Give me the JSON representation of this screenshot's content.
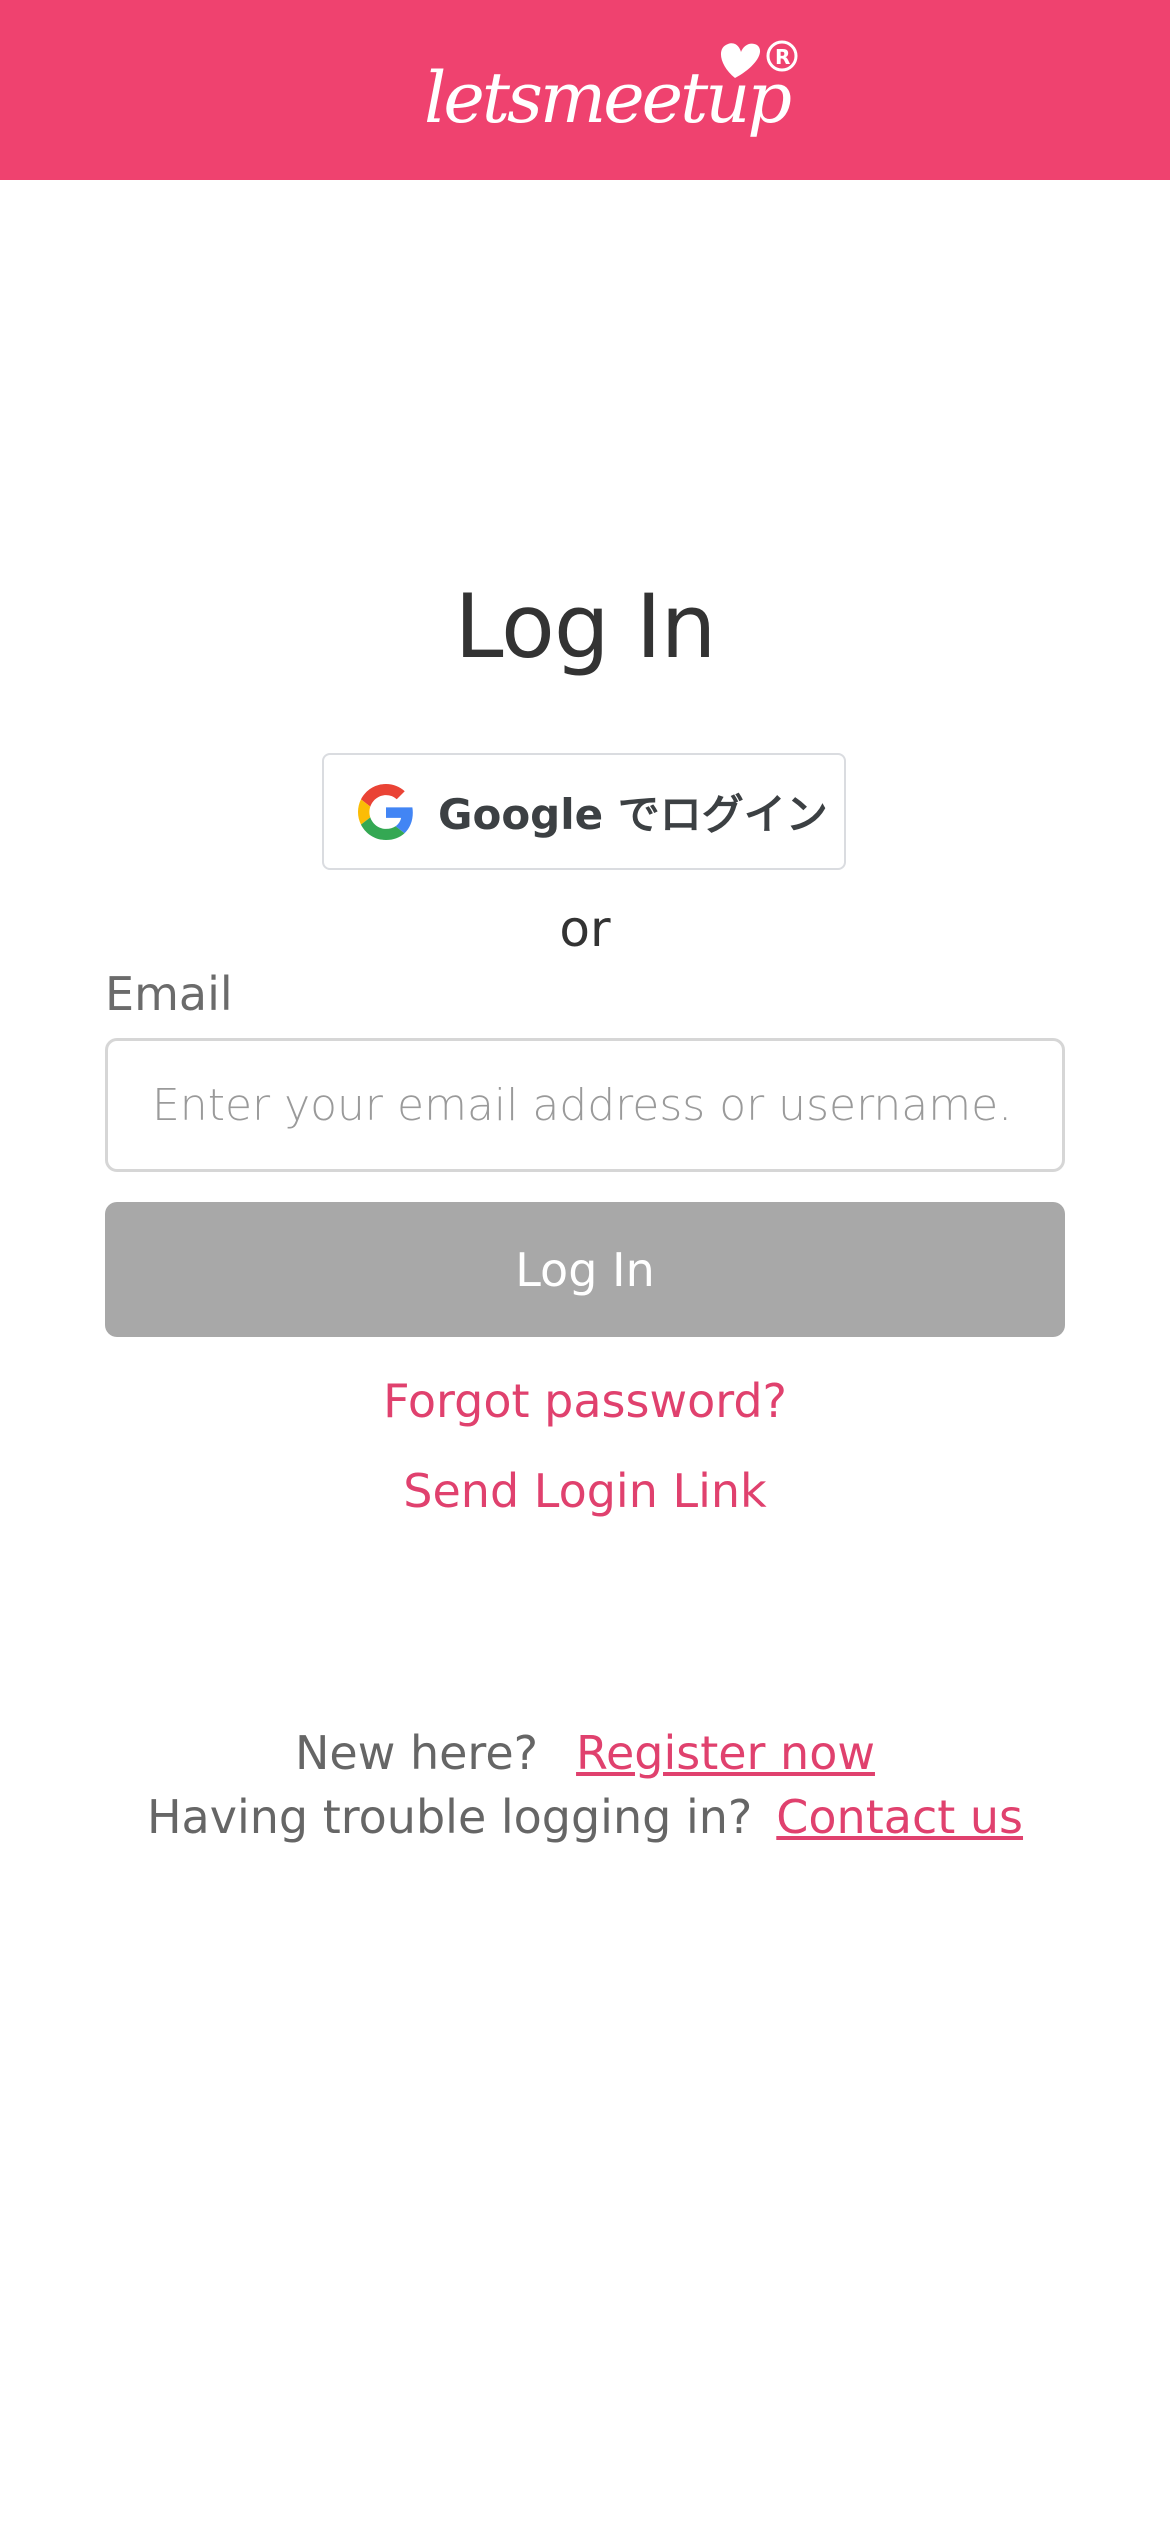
{
  "header": {
    "brand_color": "#ef426f",
    "logo_text": "letsmeetup",
    "logo_mark": "®"
  },
  "main": {
    "title": "Log In",
    "google_button": {
      "label": "Google でログイン",
      "icon": "google-g-icon"
    },
    "separator": "or",
    "email": {
      "label": "Email",
      "placeholder": "Enter your email address or username...",
      "value": ""
    },
    "login_button": "Log In",
    "forgot_password": "Forgot password?",
    "send_login_link": "Send Login Link"
  },
  "footer": {
    "new_here_text": "New here?",
    "register_link": "Register now",
    "trouble_text": "Having trouble logging in?",
    "contact_link": "Contact us"
  },
  "colors": {
    "accent": "#e0416e",
    "button_disabled": "#a8a8a8",
    "text_dark": "#333333",
    "text_muted": "#666666"
  }
}
